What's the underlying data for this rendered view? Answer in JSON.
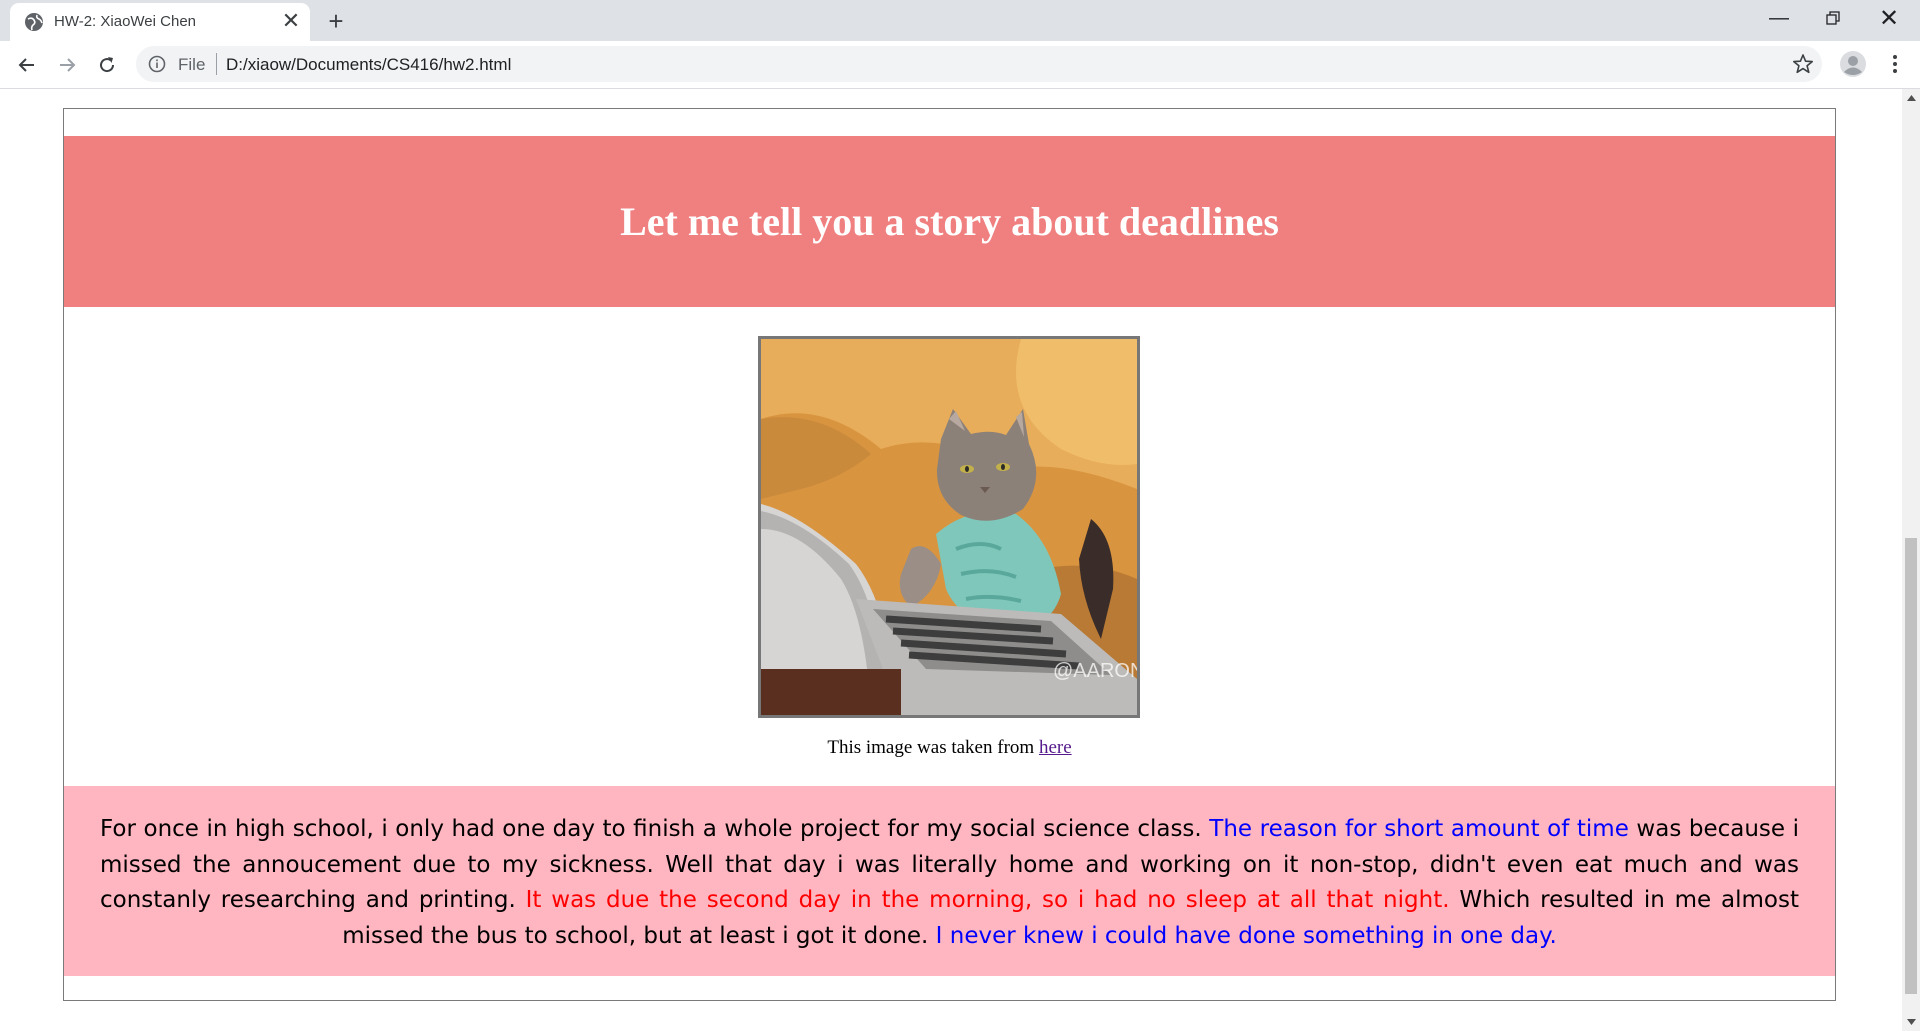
{
  "browser": {
    "tab": {
      "title": "HW-2: XiaoWei Chen",
      "favicon": "globe-icon",
      "close_glyph": "✕"
    },
    "new_tab_glyph": "+",
    "window_controls": {
      "minimize": "—",
      "close": "✕"
    },
    "address": {
      "scheme_label": "File",
      "url": "D:/xiaow/Documents/CS416/hw2.html"
    },
    "icons": [
      "back-arrow-icon",
      "forward-arrow-icon",
      "reload-icon",
      "info-icon",
      "star-icon",
      "profile-avatar-icon",
      "more-vert-icon"
    ]
  },
  "page": {
    "title": "Let me tell you a story about deadlines",
    "image_watermark": "@AARON",
    "caption": {
      "text": "This image was taken from ",
      "link_label": "here"
    },
    "story": {
      "s1": "For once in high school, i only had one day to finish a whole project for my social science class. ",
      "s2_blue": "The reason for short amount of time",
      "s3": " was because i missed the annoucement due to my sickness. Well that day i was literally home and working on it non-stop, didn't even eat much and was constanly researching and printing. ",
      "s4_red": "It was due the second day in the morning, so i had no sleep at all that night.",
      "s5": " Which resulted in me almost missed the bus to school, but at least i got it done. ",
      "s6_blue": "I never knew i could have done something in one day."
    }
  },
  "colors": {
    "header_band": "#f08080",
    "story_band": "#ffb6c1",
    "highlight_blue": "#0000ff",
    "highlight_red": "#ff0000",
    "link_visited": "#551a8b"
  }
}
